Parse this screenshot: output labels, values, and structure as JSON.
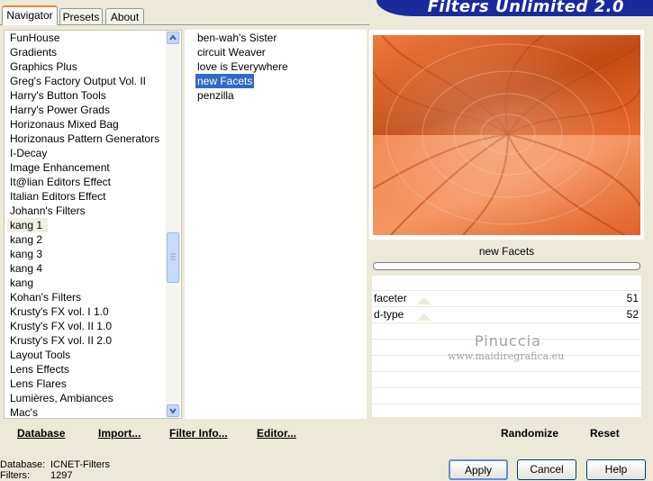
{
  "tabs": [
    "Navigator",
    "Presets",
    "About"
  ],
  "banner": "Filters Unlimited 2.0",
  "categories": [
    "FunHouse",
    "Gradients",
    "Graphics Plus",
    "Greg's Factory Output Vol. II",
    "Harry's Button Tools",
    "Harry's Power Grads",
    "Horizonaus Mixed Bag",
    "Horizonaus Pattern Generators",
    "I-Decay",
    "Image Enhancement",
    "It@lian Editors Effect",
    "Italian Editors Effect",
    "Johann's Filters",
    "kang 1",
    "kang 2",
    "kang 3",
    "kang 4",
    "kang",
    "Kohan's Filters",
    "Krusty's FX vol. I 1.0",
    "Krusty's FX vol. II 1.0",
    "Krusty's FX vol. II 2.0",
    "Layout Tools",
    "Lens Effects",
    "Lens Flares",
    "Lumières, Ambiances",
    "Mac's"
  ],
  "selected_category": "kang 1",
  "filters": [
    "ben-wah's Sister",
    "circuit Weaver",
    "love is Everywhere",
    "new Facets",
    "penzilla"
  ],
  "selected_filter": "new Facets",
  "filter_title": "new Facets",
  "params": [
    {
      "name": "faceter",
      "value": "51"
    },
    {
      "name": "d-type",
      "value": "52"
    }
  ],
  "watermark": {
    "line1": "Pinuccia",
    "line2": "www.maidiregrafica.eu"
  },
  "bottom_links": [
    "Database",
    "Import...",
    "Filter Info...",
    "Editor..."
  ],
  "randomize": "Randomize",
  "reset": "Reset",
  "status": {
    "db_label": "Database:",
    "db_value": "ICNET-Filters",
    "filters_label": "Filters:",
    "filters_value": "1297"
  },
  "buttons": {
    "apply": "Apply",
    "cancel": "Cancel",
    "help": "Help"
  },
  "colors": {
    "selection": "#316ac5",
    "banner": "#1a2a9c",
    "tab_accent": "#e68b2c"
  }
}
